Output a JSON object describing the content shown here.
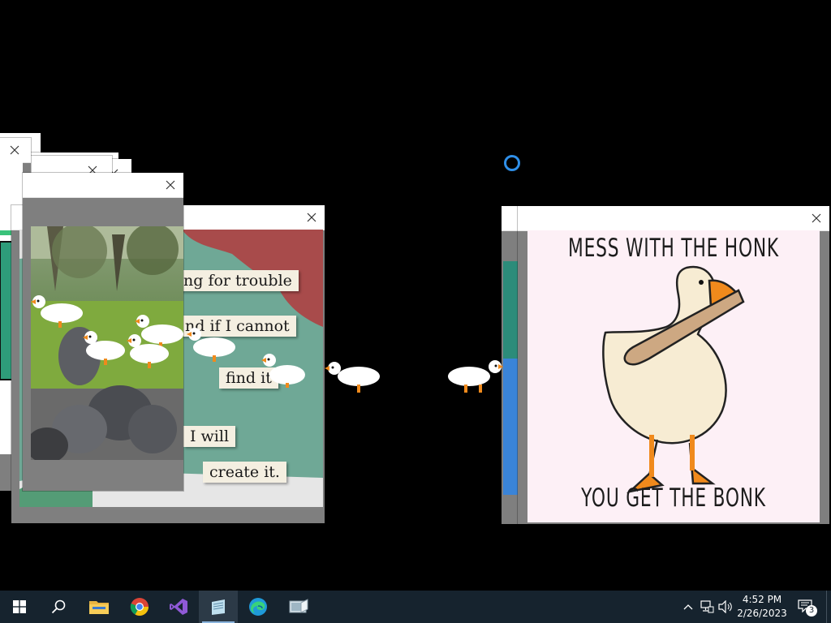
{
  "popups": {
    "trouble_meme": {
      "lines": [
        "ng for trouble",
        "nd if I cannot",
        "find it",
        "I will",
        "create it."
      ]
    },
    "honk_meme": {
      "top_text": "MESS WITH THE HONK",
      "bottom_text": "YOU GET THE BONK"
    }
  },
  "taskbar": {
    "apps": [
      "start-icon",
      "search-icon",
      "file-explorer-icon",
      "chrome-icon",
      "visual-studio-icon",
      "notepad-icon",
      "edge-icon",
      "desktop-goose-icon"
    ],
    "clock": {
      "time": "4:52 PM",
      "date": "2/26/2023"
    },
    "notifications_count": "3"
  },
  "colors": {
    "taskbar_bg": "#16232e",
    "window_frame": "#7f7f7f",
    "meme_teal": "#6fa896",
    "meme_red": "#a84b4b",
    "honk_bg": "#fdf0f6",
    "goose_orange": "#f08a1c",
    "cursor_ring": "#2f8fe8"
  }
}
